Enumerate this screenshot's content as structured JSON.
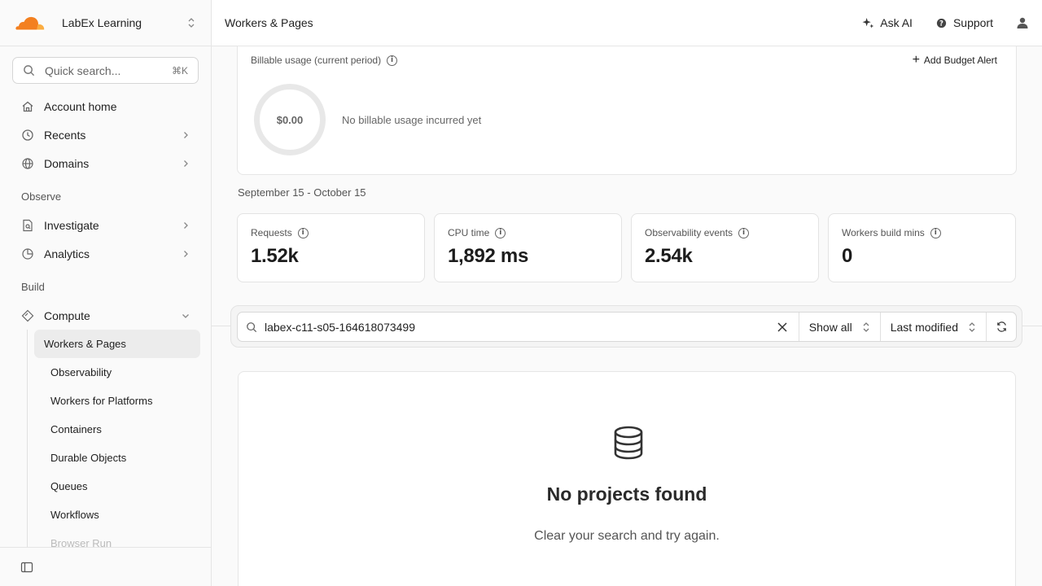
{
  "sidebar": {
    "account_name": "LabEx Learning",
    "search": {
      "placeholder": "Quick search...",
      "shortcut": "⌘K"
    },
    "items_top": [
      {
        "label": "Account home",
        "icon": "home-icon"
      },
      {
        "label": "Recents",
        "icon": "clock-icon"
      },
      {
        "label": "Domains",
        "icon": "globe-icon"
      }
    ],
    "observe_section": "Observe",
    "items_observe": [
      {
        "label": "Investigate",
        "icon": "document-search-icon"
      },
      {
        "label": "Analytics",
        "icon": "pie-chart-icon"
      }
    ],
    "build_section": "Build",
    "compute": {
      "label": "Compute",
      "icon": "diamond-icon"
    },
    "compute_sub": [
      "Workers & Pages",
      "Observability",
      "Workers for Platforms",
      "Containers",
      "Durable Objects",
      "Queues",
      "Workflows",
      "Browser Run"
    ]
  },
  "topbar": {
    "title": "Workers & Pages",
    "ask_ai": "Ask AI",
    "support": "Support"
  },
  "billing": {
    "title": "Billable usage (current period)",
    "add_budget": "Add Budget Alert",
    "amount": "$0.00",
    "message": "No billable usage incurred yet"
  },
  "period": "September 15 - October 15",
  "stats": [
    {
      "label": "Requests",
      "value": "1.52k"
    },
    {
      "label": "CPU time",
      "value": "1,892 ms"
    },
    {
      "label": "Observability events",
      "value": "2.54k"
    },
    {
      "label": "Workers build mins",
      "value": "0"
    }
  ],
  "filter": {
    "search_value": "labex-c11-s05-164618073499",
    "show_all": "Show all",
    "sort": "Last modified"
  },
  "empty": {
    "title": "No projects found",
    "subtitle": "Clear your search and try again."
  },
  "colors": {
    "brand_orange": "#F38020",
    "brand_orange_light": "#FBAD41"
  }
}
